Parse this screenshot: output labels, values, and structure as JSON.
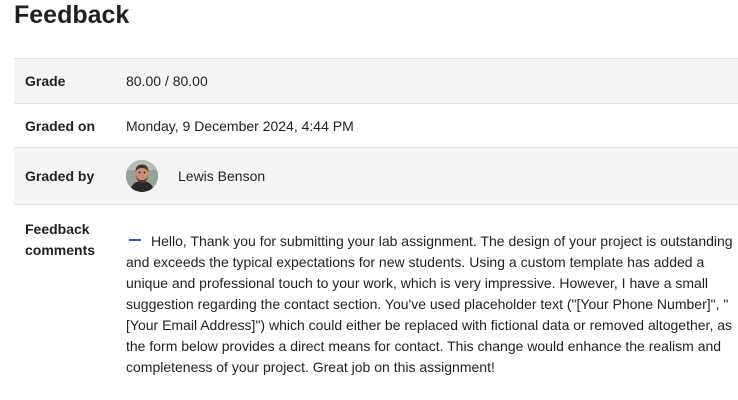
{
  "page": {
    "heading": "Feedback"
  },
  "feedback": {
    "grade": {
      "label": "Grade",
      "value": "80.00 / 80.00"
    },
    "graded_on": {
      "label": "Graded on",
      "value": "Monday, 9 December 2024, 4:44 PM"
    },
    "graded_by": {
      "label": "Graded by",
      "name": "Lewis Benson",
      "avatar_icon": "user-avatar"
    },
    "comments": {
      "label_line1": "Feedback",
      "label_line2": "comments",
      "toggle_icon": "collapse-minus-icon",
      "text": "Hello, Thank you for submitting your lab assignment. The design of your project is outstanding and exceeds the typical expectations for new students. Using a custom template has added a unique and professional touch to your work, which is very impressive. However, I have a small suggestion regarding the contact section. You've used placeholder text (\"[Your Phone Number]\", \"[Your Email Address]\") which could either be replaced with fictional data or removed altogether, as the form below provides a direct means for contact. This change would enhance the realism and completeness of your project. Great job on this assignment!"
    }
  },
  "colors": {
    "accent": "#0f6cbf",
    "row_shade": "#f5f5f5",
    "border": "#dee2e6",
    "text": "#1d2125"
  }
}
